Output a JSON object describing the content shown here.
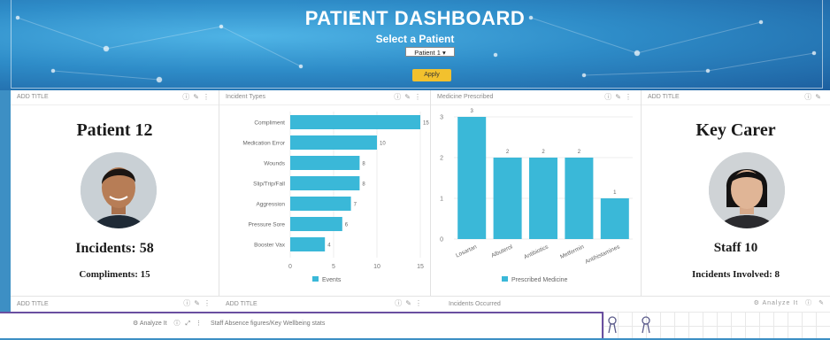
{
  "header": {
    "title": "PATIENT DASHBOARD",
    "subtitle": "Select a Patient",
    "patient_select": "Patient 1",
    "apply_label": "Apply"
  },
  "panels": {
    "patient": {
      "title": "ADD TITLE",
      "name": "Patient 12",
      "incidents": "Incidents: 58",
      "compliments": "Compliments: 15"
    },
    "incident_types": {
      "title": "Incident Types",
      "legend": "Events"
    },
    "medicine": {
      "title": "Medicine Prescribed",
      "legend": "Prescribed Medicine"
    },
    "carer": {
      "title": "ADD TITLE",
      "name": "Key Carer",
      "staff": "Staff 10",
      "incidents_involved": "Incidents Involved: 8"
    }
  },
  "row2": {
    "p1_title": "ADD TITLE",
    "p2_title": "ADD TITLE",
    "p3_title": "Incidents Occurred",
    "analyze_label": "Analyze It"
  },
  "bottom_window": {
    "analyze_label": "Analyze It",
    "title": "Staff Absence figures/Key Wellbeing stats"
  },
  "colors": {
    "bar": "#3ab8d8",
    "apply": "#f2c12e",
    "window_border": "#6a4fa0"
  },
  "chart_data": [
    {
      "type": "bar",
      "orientation": "horizontal",
      "title": "Incident Types",
      "categories": [
        "Compliment",
        "Medication Error",
        "Wounds",
        "Slip/Trip/Fall",
        "Aggression",
        "Pressure Sore",
        "Booster Vax"
      ],
      "series": [
        {
          "name": "Events",
          "values": [
            15,
            10,
            8,
            8,
            7,
            6,
            4
          ]
        }
      ],
      "xlim": [
        0,
        15
      ],
      "xticks": [
        0,
        5,
        10,
        15
      ],
      "legend": "bottom"
    },
    {
      "type": "bar",
      "title": "Medicine Prescribed",
      "categories": [
        "Losartan",
        "Albuterol",
        "Antibiotics",
        "Metformin",
        "Antihistamines"
      ],
      "series": [
        {
          "name": "Prescribed Medicine",
          "values": [
            3,
            2,
            2,
            2,
            1
          ]
        }
      ],
      "ylim": [
        0,
        3
      ],
      "yticks": [
        0,
        1,
        2,
        3
      ],
      "legend": "bottom"
    }
  ]
}
